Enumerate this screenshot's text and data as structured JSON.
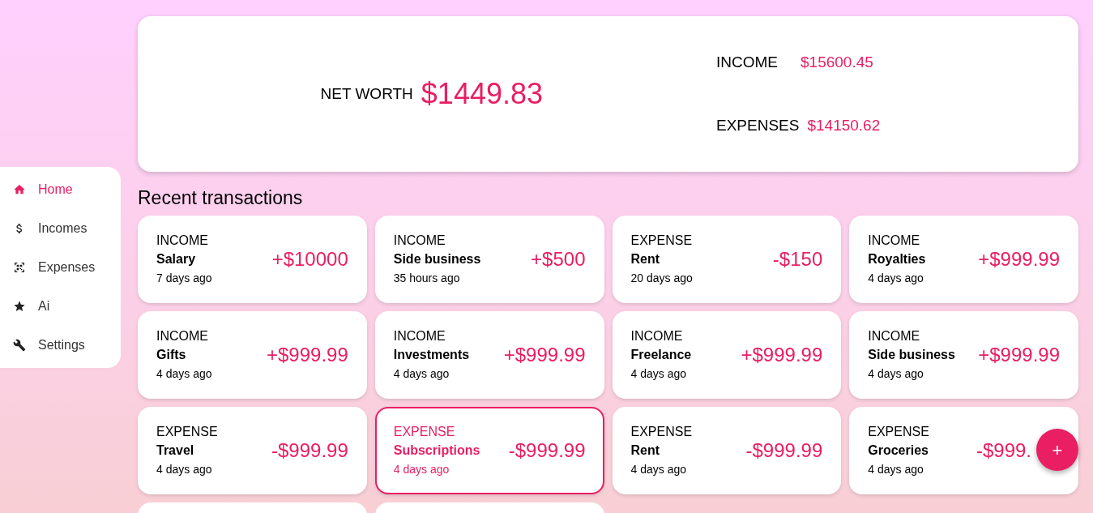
{
  "sidebar": {
    "items": [
      {
        "label": "Home",
        "kind": "home",
        "selected": true
      },
      {
        "label": "Incomes",
        "kind": "dollar",
        "selected": false
      },
      {
        "label": "Expenses",
        "kind": "qr",
        "selected": false
      },
      {
        "label": "Ai",
        "kind": "star",
        "selected": false
      },
      {
        "label": "Settings",
        "kind": "wrench",
        "selected": false
      }
    ]
  },
  "summary": {
    "net_worth_label": "NET WORTH",
    "net_worth": "$1449.83",
    "income_label": "INCOME",
    "income": "$15600.45",
    "expenses_label": "EXPENSES",
    "expenses": "$14150.62"
  },
  "heading": "Recent transactions",
  "transactions": [
    {
      "type": "INCOME",
      "name": "Salary",
      "time": "7 days ago",
      "amount": "+$10000",
      "selected": false
    },
    {
      "type": "INCOME",
      "name": "Side business",
      "time": "35 hours ago",
      "amount": "+$500",
      "selected": false
    },
    {
      "type": "EXPENSE",
      "name": "Rent",
      "time": "20 days ago",
      "amount": "-$150",
      "selected": false
    },
    {
      "type": "INCOME",
      "name": "Royalties",
      "time": "4 days ago",
      "amount": "+$999.99",
      "selected": false
    },
    {
      "type": "INCOME",
      "name": "Gifts",
      "time": "4 days ago",
      "amount": "+$999.99",
      "selected": false
    },
    {
      "type": "INCOME",
      "name": "Investments",
      "time": "4 days ago",
      "amount": "+$999.99",
      "selected": false
    },
    {
      "type": "INCOME",
      "name": "Freelance",
      "time": "4 days ago",
      "amount": "+$999.99",
      "selected": false
    },
    {
      "type": "INCOME",
      "name": "Side business",
      "time": "4 days ago",
      "amount": "+$999.99",
      "selected": false
    },
    {
      "type": "EXPENSE",
      "name": "Travel",
      "time": "4 days ago",
      "amount": "-$999.99",
      "selected": false
    },
    {
      "type": "EXPENSE",
      "name": "Subscriptions",
      "time": "4 days ago",
      "amount": "-$999.99",
      "selected": true
    },
    {
      "type": "EXPENSE",
      "name": "Rent",
      "time": "4 days ago",
      "amount": "-$999.99",
      "selected": false
    },
    {
      "type": "EXPENSE",
      "name": "Groceries",
      "time": "4 days ago",
      "amount": "-$999.",
      "selected": false
    }
  ],
  "fab": {
    "label": "+"
  }
}
